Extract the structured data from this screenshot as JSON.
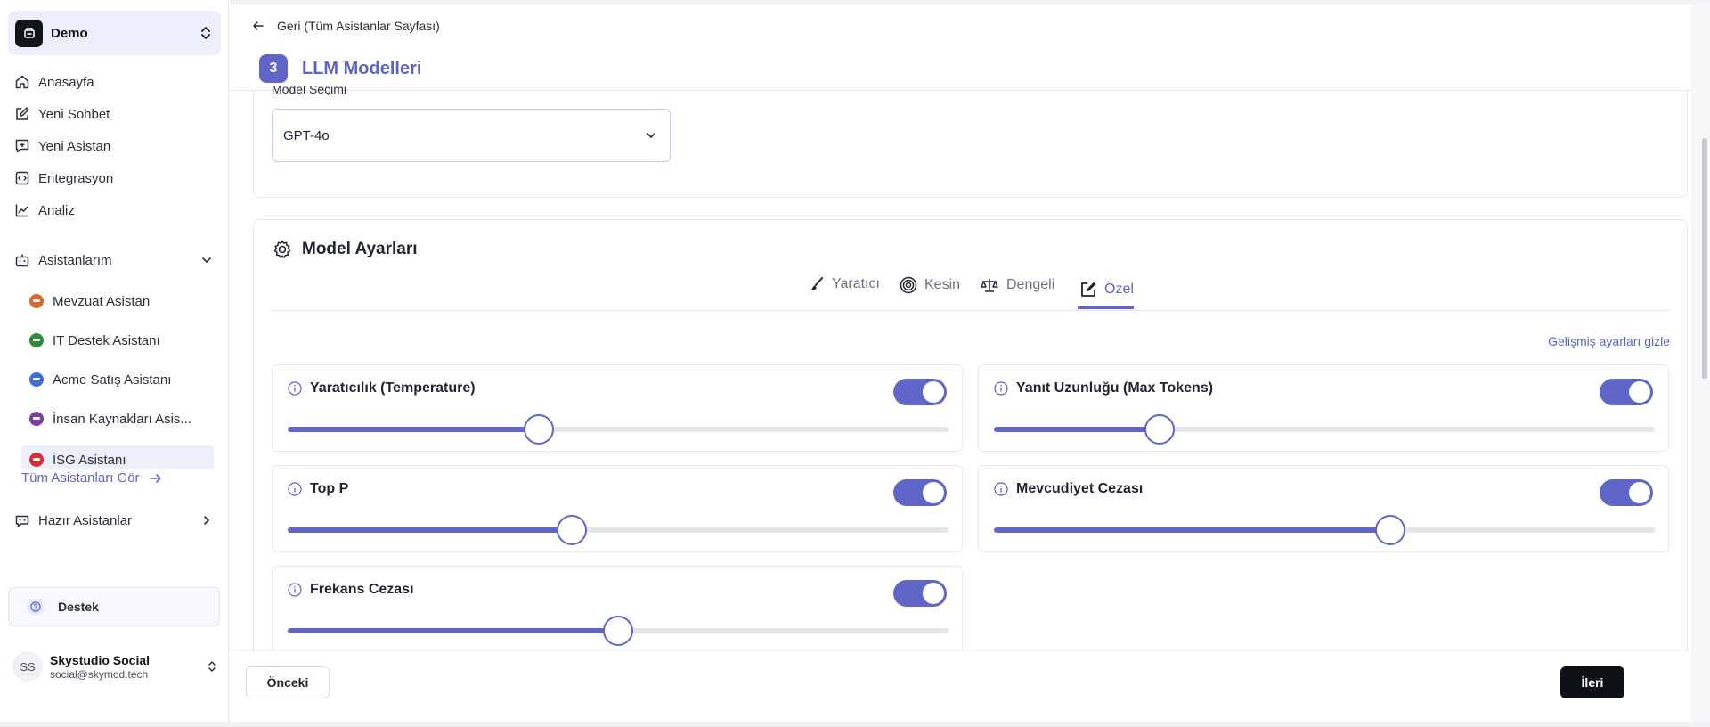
{
  "workspace": {
    "name": "Demo"
  },
  "nav": [
    {
      "label": "Anasayfa",
      "icon": "home-icon"
    },
    {
      "label": "Yeni Sohbet",
      "icon": "edit-icon"
    },
    {
      "label": "Yeni Asistan",
      "icon": "message-plus-icon"
    },
    {
      "label": "Entegrasyon",
      "icon": "code-icon"
    },
    {
      "label": "Analiz",
      "icon": "chart-line-icon"
    }
  ],
  "assistants": {
    "label": "Asistanlarım",
    "items": [
      {
        "label": "Mevzuat Asistan",
        "color": "#d9682b"
      },
      {
        "label": "IT Destek Asistanı",
        "color": "#2e8b3c"
      },
      {
        "label": "Acme Satış Asistanı",
        "color": "#3b6fd4"
      },
      {
        "label": "İnsan Kaynakları Asis...",
        "color": "#7a3fa0"
      },
      {
        "label": "İSG Asistanı",
        "color": "#d2333a"
      }
    ],
    "see_all": "Tüm Asistanları Gör"
  },
  "ready_assistants": "Hazır Asistanlar",
  "support": "Destek",
  "user": {
    "initials": "SS",
    "name": "Skystudio Social",
    "email": "social@skymod.tech"
  },
  "header": {
    "back": "Geri (Tüm Asistanlar Sayfası)",
    "step_number": "3",
    "step_title": "LLM Modelleri"
  },
  "model": {
    "label": "Model Seçimi",
    "selected": "GPT-4o"
  },
  "settings": {
    "title": "Model Ayarları",
    "tabs": [
      {
        "label": "Yaratıcı",
        "icon": "brush-icon"
      },
      {
        "label": "Kesin",
        "icon": "target-icon"
      },
      {
        "label": "Dengeli",
        "icon": "scale-icon"
      },
      {
        "label": "Özel",
        "icon": "edit-square-icon",
        "active": true
      }
    ],
    "advanced_link": "Gelişmiş ayarları gizle",
    "params": [
      {
        "name": "Yaratıcılık (Temperature)",
        "enabled": true,
        "level": 0.38
      },
      {
        "name": "Yanıt Uzunluğu (Max Tokens)",
        "enabled": true,
        "level": 0.25
      },
      {
        "name": "Top P",
        "enabled": true,
        "level": 0.43
      },
      {
        "name": "Mevcudiyet Cezası",
        "enabled": true,
        "level": 0.6
      },
      {
        "name": "Frekans Cezası",
        "enabled": true,
        "level": 0.5
      }
    ]
  },
  "footer": {
    "prev": "Önceki",
    "next": "İleri"
  },
  "colors": {
    "accent": "#5f66c8",
    "accent_text": "#5b63c9",
    "primary_button": "#0e1116"
  }
}
